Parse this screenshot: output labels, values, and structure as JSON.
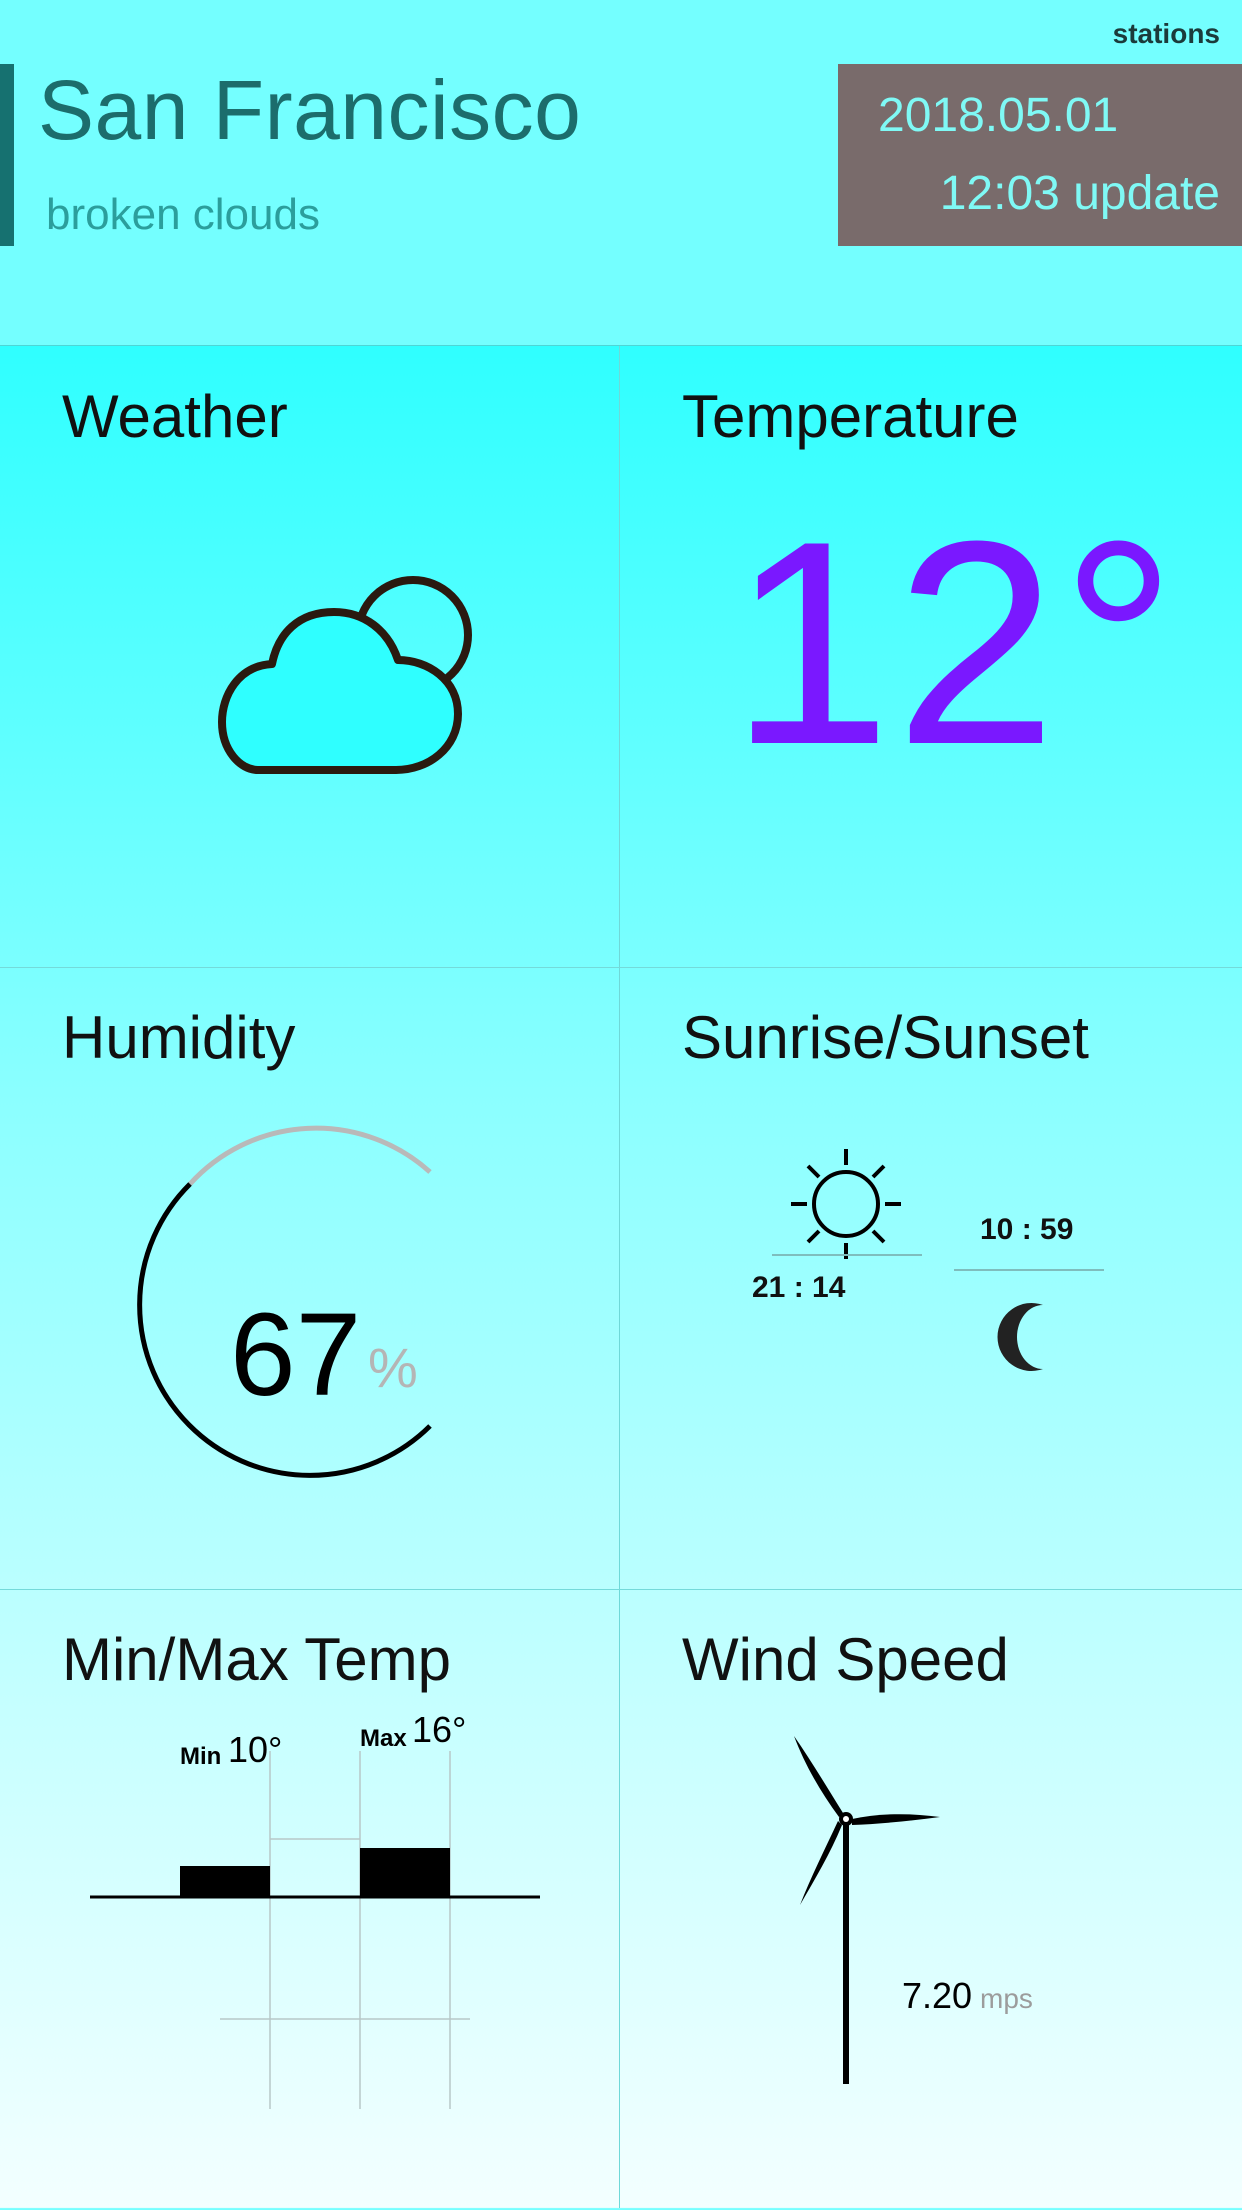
{
  "header": {
    "stations_link": "stations",
    "city": "San Francisco",
    "description": "broken clouds",
    "date": "2018.05.01",
    "update": "12:03 update"
  },
  "cards": {
    "weather": {
      "title": "Weather",
      "icon": "partly-cloudy-icon"
    },
    "temperature": {
      "title": "Temperature",
      "value": "12°",
      "color": "#7a18ff"
    },
    "humidity": {
      "title": "Humidity",
      "value": "67",
      "unit": "%",
      "fraction": 0.67
    },
    "sun": {
      "title": "Sunrise/Sunset",
      "sun_time": "21 : 14",
      "moon_time": "10 : 59",
      "sun_icon": "sun-icon",
      "moon_icon": "moon-icon"
    },
    "minmax": {
      "title": "Min/Max Temp",
      "min_label": "Min",
      "min_value": "10°",
      "max_label": "Max",
      "max_value": "16°"
    },
    "wind": {
      "title": "Wind Speed",
      "value": "7.20",
      "unit": "mps",
      "icon": "wind-turbine-icon"
    }
  },
  "colors": {
    "accent_dark": "#167170",
    "date_box": "#796b6b",
    "date_text": "#7ff9f5"
  }
}
